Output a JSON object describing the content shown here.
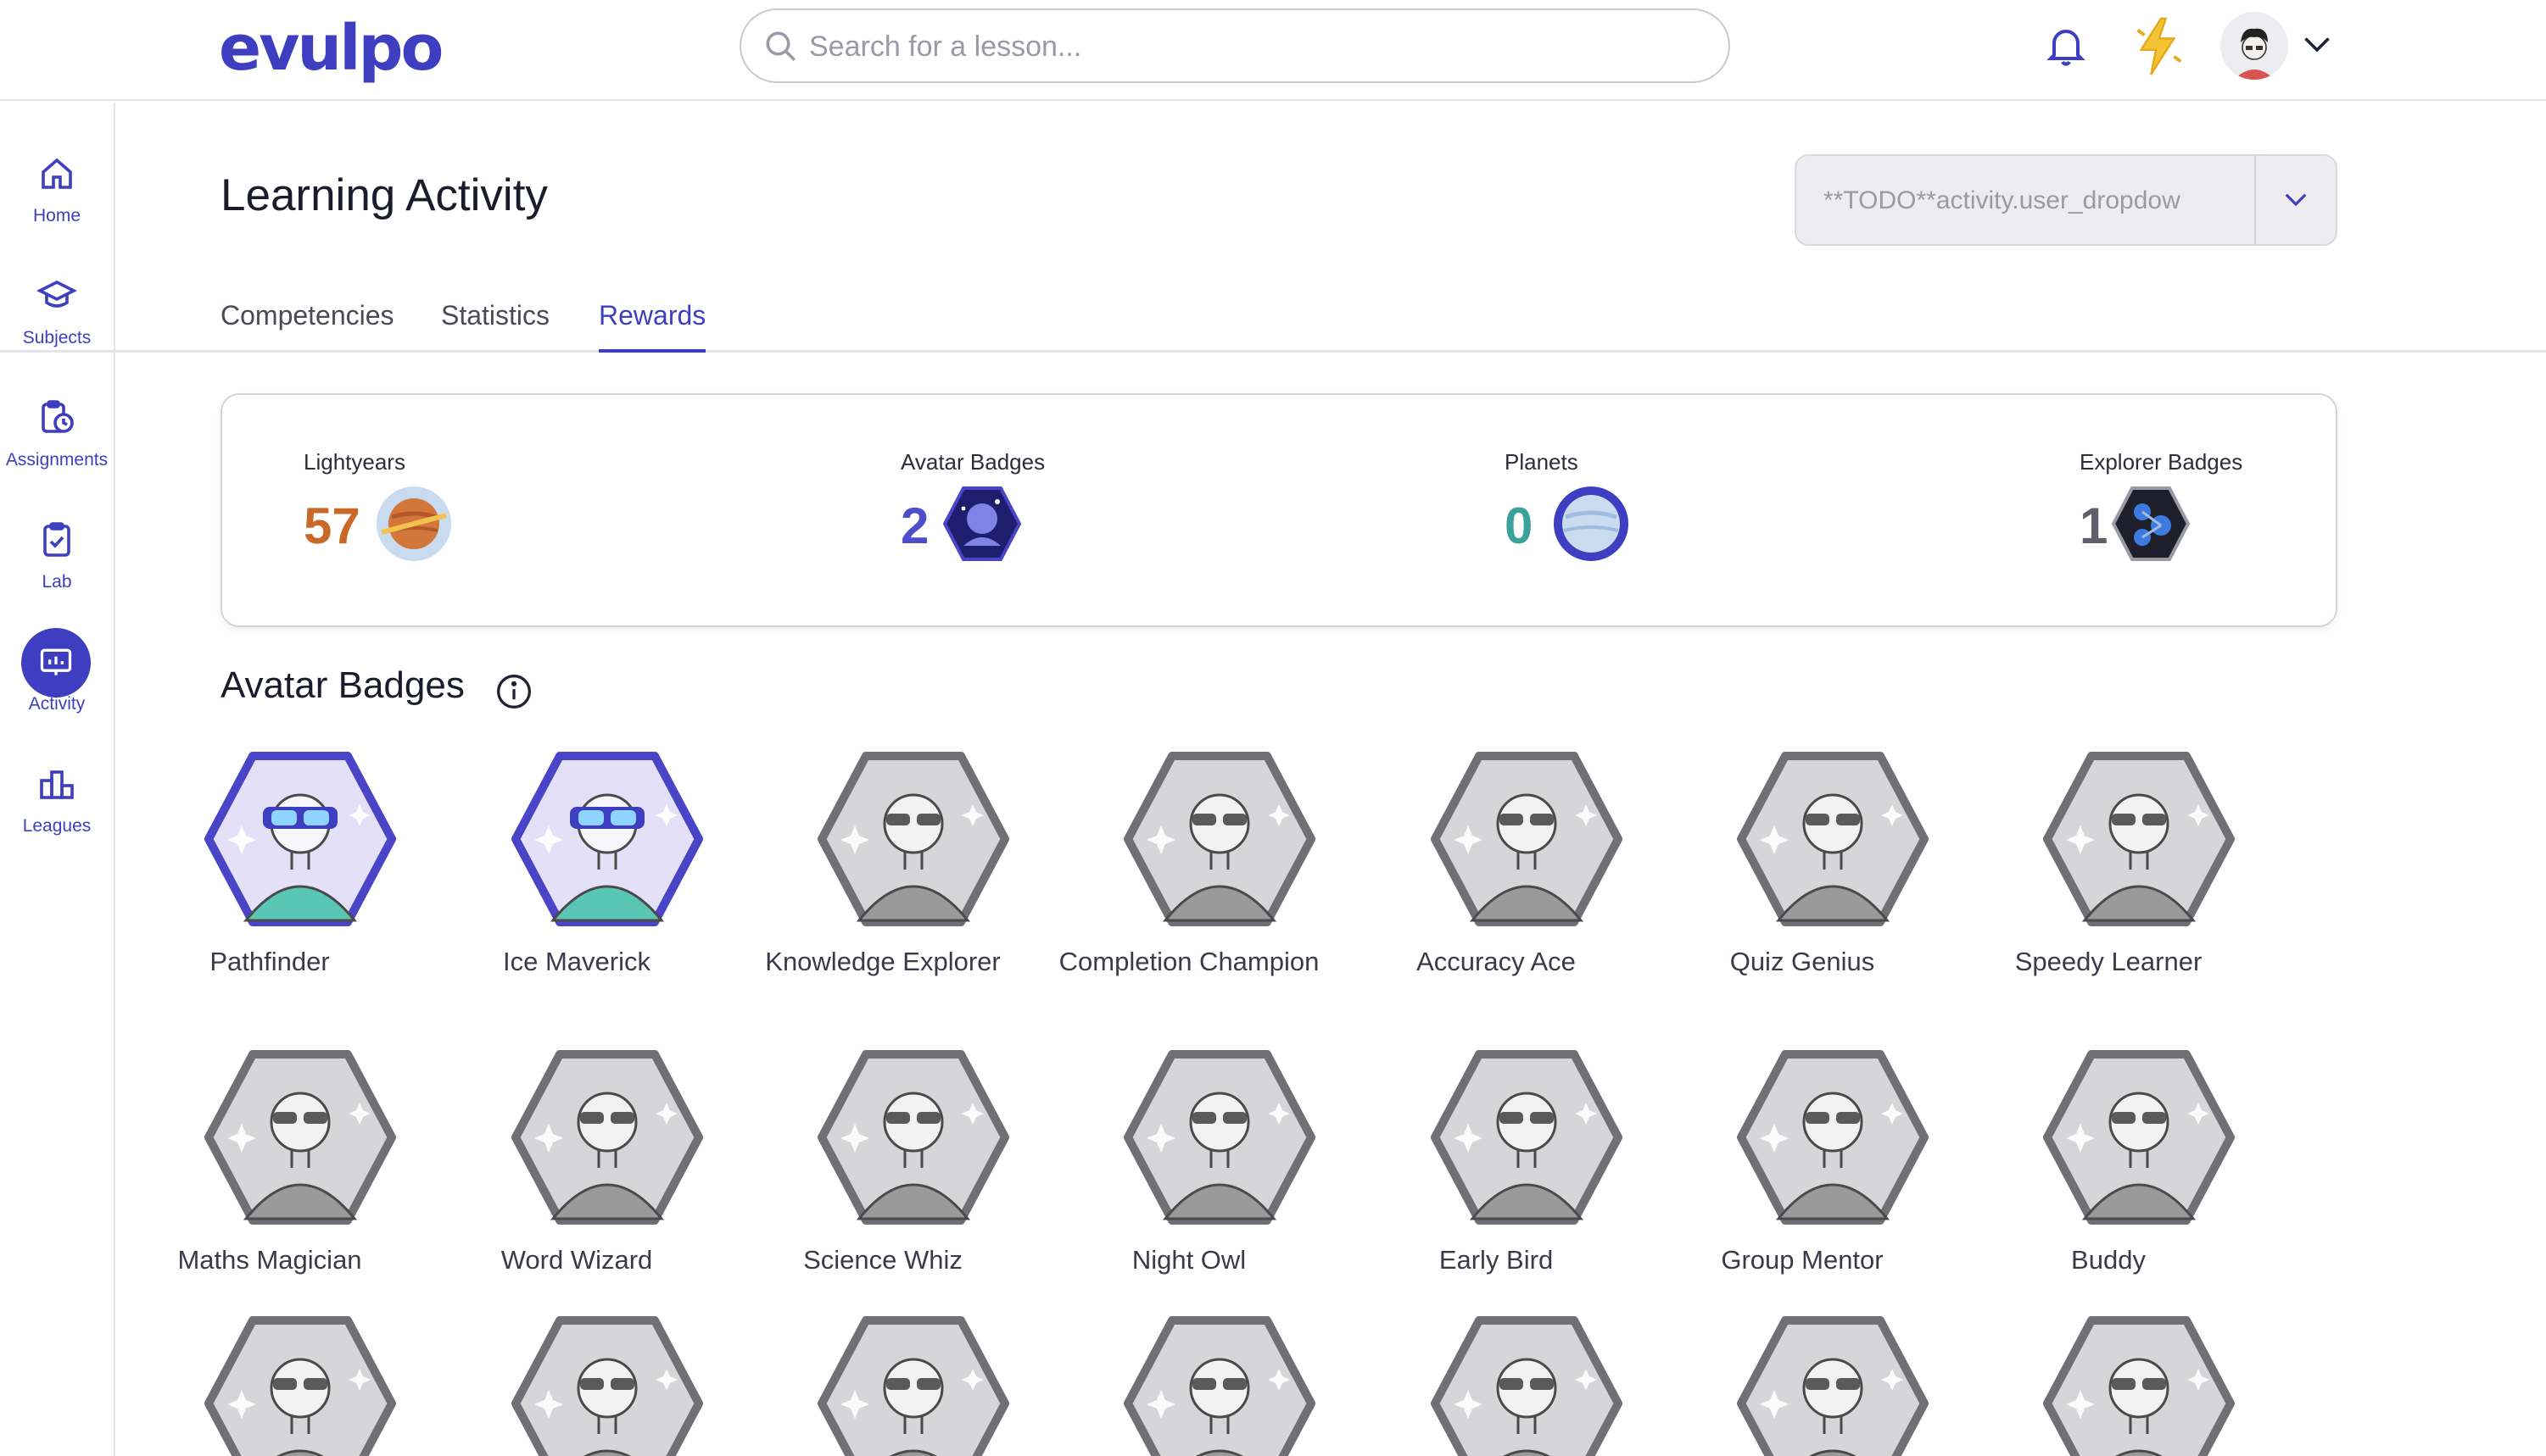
{
  "header": {
    "logo": "evulpo",
    "search_placeholder": "Search for a lesson...",
    "icons": [
      "search-icon",
      "bell-icon",
      "lightning-bolt-icon",
      "user-avatar",
      "chevron-down-icon"
    ]
  },
  "sidebar": {
    "items": [
      {
        "label": "Home",
        "icon": "home-icon"
      },
      {
        "label": "Subjects",
        "icon": "graduation-cap-icon"
      },
      {
        "label": "Assignments",
        "icon": "clipboard-clock-icon"
      },
      {
        "label": "Lab",
        "icon": "clipboard-check-icon"
      },
      {
        "label": "Activity",
        "icon": "chart-board-icon"
      },
      {
        "label": "Leagues",
        "icon": "podium-icon"
      }
    ],
    "active": "Activity"
  },
  "page": {
    "title": "Learning Activity",
    "user_dropdown_value": "**TODO**activity.user_dropdow"
  },
  "tabs": [
    {
      "label": "Competencies"
    },
    {
      "label": "Statistics"
    },
    {
      "label": "Rewards"
    }
  ],
  "active_tab": "Rewards",
  "summary": [
    {
      "label": "Lightyears",
      "value": "57",
      "color": "#c8692a",
      "icon": "planet-orange-icon"
    },
    {
      "label": "Avatar Badges",
      "value": "2",
      "color": "#4b4fc9",
      "icon": "avatar-badge-hex-icon"
    },
    {
      "label": "Planets",
      "value": "0",
      "color": "#3aa29a",
      "icon": "planet-blue-icon"
    },
    {
      "label": "Explorer Badges",
      "value": "1",
      "color": "#5f606c",
      "icon": "explorer-badge-hex-icon"
    }
  ],
  "section": {
    "title": "Avatar Badges",
    "info_icon": "info-icon"
  },
  "badges": [
    {
      "name": "Pathfinder",
      "unlocked": true
    },
    {
      "name": "Ice Maverick",
      "unlocked": true
    },
    {
      "name": "Knowledge Explorer",
      "unlocked": false
    },
    {
      "name": "Completion Champion",
      "unlocked": false
    },
    {
      "name": "Accuracy Ace",
      "unlocked": false
    },
    {
      "name": "Quiz Genius",
      "unlocked": false
    },
    {
      "name": "Speedy Learner",
      "unlocked": false
    },
    {
      "name": "Maths Magician",
      "unlocked": false
    },
    {
      "name": "Word Wizard",
      "unlocked": false
    },
    {
      "name": "Science Whiz",
      "unlocked": false
    },
    {
      "name": "Night Owl",
      "unlocked": false
    },
    {
      "name": "Early Bird",
      "unlocked": false
    },
    {
      "name": "Group Mentor",
      "unlocked": false
    },
    {
      "name": "Buddy",
      "unlocked": false
    },
    {
      "name": "",
      "unlocked": false
    },
    {
      "name": "",
      "unlocked": false
    },
    {
      "name": "",
      "unlocked": false
    },
    {
      "name": "",
      "unlocked": false
    },
    {
      "name": "",
      "unlocked": false
    },
    {
      "name": "",
      "unlocked": false
    },
    {
      "name": "",
      "unlocked": false
    }
  ],
  "colors": {
    "brand": "#3d3fc0",
    "locked_border": "#6f6f76",
    "locked_fill": "#d6d6d9",
    "unlocked_border": "#4a44c6",
    "unlocked_fill": "#e3e0f7"
  }
}
